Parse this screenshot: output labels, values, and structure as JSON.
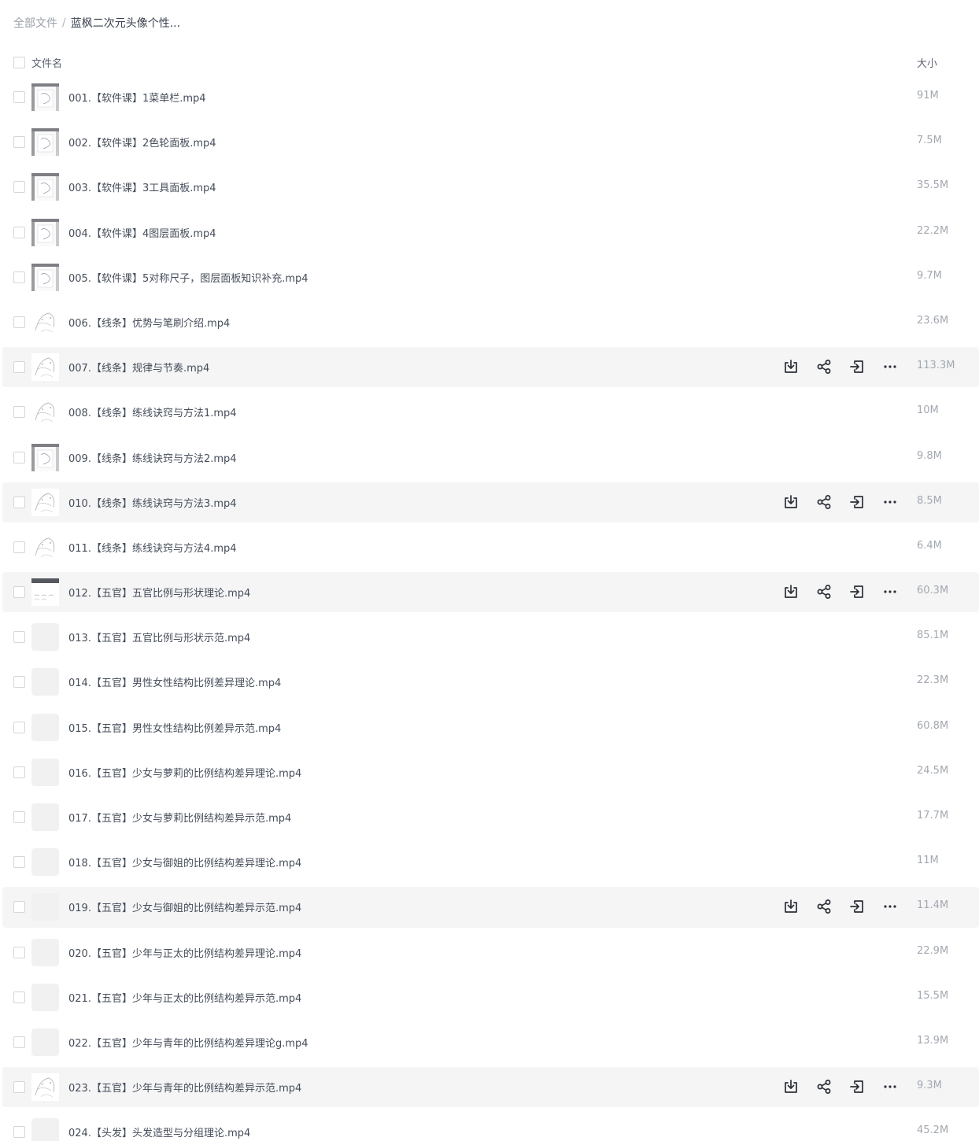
{
  "breadcrumb": {
    "root": "全部文件",
    "separator": "/",
    "current": "蓝枫二次元头像个性..."
  },
  "table": {
    "header_name": "文件名",
    "header_size": "大小"
  },
  "row_actions": [
    "download-icon",
    "share-icon",
    "move-icon",
    "more-icon"
  ],
  "files": [
    {
      "name": "001.【软件课】1菜单栏.mp4",
      "size": "91M",
      "thumb": "screenshot",
      "hover": false
    },
    {
      "name": "002.【软件课】2色轮面板.mp4",
      "size": "7.5M",
      "thumb": "screenshot",
      "hover": false
    },
    {
      "name": "003.【软件课】3工具面板.mp4",
      "size": "35.5M",
      "thumb": "screenshot",
      "hover": false
    },
    {
      "name": "004.【软件课】4图层面板.mp4",
      "size": "22.2M",
      "thumb": "screenshot",
      "hover": false
    },
    {
      "name": "005.【软件课】5对称尺子，图层面板知识补充.mp4",
      "size": "9.7M",
      "thumb": "screenshot",
      "hover": false
    },
    {
      "name": "006.【线条】优势与笔刷介绍.mp4",
      "size": "23.6M",
      "thumb": "sketch",
      "hover": false
    },
    {
      "name": "007.【线条】规律与节奏.mp4",
      "size": "113.3M",
      "thumb": "sketch",
      "hover": true
    },
    {
      "name": "008.【线条】练线诀窍与方法1.mp4",
      "size": "10M",
      "thumb": "sketch",
      "hover": false
    },
    {
      "name": "009.【线条】练线诀窍与方法2.mp4",
      "size": "9.8M",
      "thumb": "screenshot",
      "hover": false
    },
    {
      "name": "010.【线条】练线诀窍与方法3.mp4",
      "size": "8.5M",
      "thumb": "sketch",
      "hover": true
    },
    {
      "name": "011.【线条】练线诀窍与方法4.mp4",
      "size": "6.4M",
      "thumb": "sketch",
      "hover": false
    },
    {
      "name": "012.【五官】五官比例与形状理论.mp4",
      "size": "60.3M",
      "thumb": "slide",
      "hover": true
    },
    {
      "name": "013.【五官】五官比例与形状示范.mp4",
      "size": "85.1M",
      "thumb": "placeholder",
      "hover": false
    },
    {
      "name": "014.【五官】男性女性结构比例差异理论.mp4",
      "size": "22.3M",
      "thumb": "placeholder",
      "hover": false
    },
    {
      "name": "015.【五官】男性女性结构比例差异示范.mp4",
      "size": "60.8M",
      "thumb": "placeholder",
      "hover": false
    },
    {
      "name": "016.【五官】少女与萝莉的比例结构差异理论.mp4",
      "size": "24.5M",
      "thumb": "placeholder",
      "hover": false
    },
    {
      "name": "017.【五官】少女与萝莉比例结构差异示范.mp4",
      "size": "17.7M",
      "thumb": "placeholder",
      "hover": false
    },
    {
      "name": "018.【五官】少女与御姐的比例结构差异理论.mp4",
      "size": "11M",
      "thumb": "placeholder",
      "hover": false
    },
    {
      "name": "019.【五官】少女与御姐的比例结构差异示范.mp4",
      "size": "11.4M",
      "thumb": "placeholder",
      "hover": true
    },
    {
      "name": "020.【五官】少年与正太的比例结构差异理论.mp4",
      "size": "22.9M",
      "thumb": "placeholder",
      "hover": false
    },
    {
      "name": "021.【五官】少年与正太的比例结构差异示范.mp4",
      "size": "15.5M",
      "thumb": "placeholder",
      "hover": false
    },
    {
      "name": "022.【五官】少年与青年的比例结构差异理论g.mp4",
      "size": "13.9M",
      "thumb": "placeholder",
      "hover": false
    },
    {
      "name": "023.【五官】少年与青年的比例结构差异示范.mp4",
      "size": "9.3M",
      "thumb": "sketch",
      "hover": true
    },
    {
      "name": "024.【头发】头发造型与分组理论.mp4",
      "size": "45.2M",
      "thumb": "placeholder",
      "hover": false
    }
  ]
}
